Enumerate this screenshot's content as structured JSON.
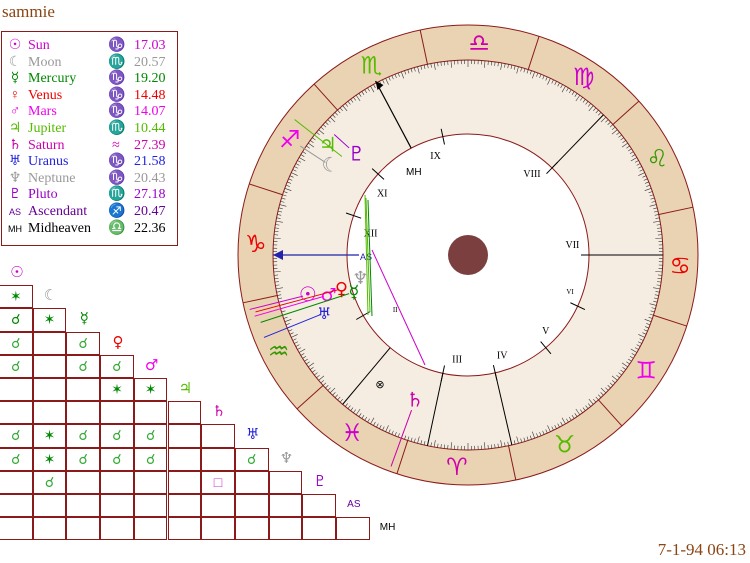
{
  "chart_title": "sammie",
  "datetime": "7-1-94 06:13",
  "colors": {
    "border": "#8b1a1a",
    "ring": "#ead3b2",
    "inner": "#f5ede2",
    "center": "#7b3f3f",
    "text": "#8b4513"
  },
  "planets": [
    {
      "key": "sun",
      "glyph": "☉",
      "name": "Sun",
      "sign": "♑",
      "degree": "17.03",
      "color": "#cc00cc"
    },
    {
      "key": "moon",
      "glyph": "☾",
      "name": "Moon",
      "sign": "♏",
      "degree": "20.57",
      "color": "#999999"
    },
    {
      "key": "mercury",
      "glyph": "☿",
      "name": "Mercury",
      "sign": "♑",
      "degree": "19.20",
      "color": "#008800"
    },
    {
      "key": "venus",
      "glyph": "♀",
      "name": "Venus",
      "sign": "♑",
      "degree": "14.48",
      "color": "#ee0000"
    },
    {
      "key": "mars",
      "glyph": "♂",
      "name": "Mars",
      "sign": "♑",
      "degree": "14.07",
      "color": "#ee00ee"
    },
    {
      "key": "jupiter",
      "glyph": "♃",
      "name": "Jupiter",
      "sign": "♏",
      "degree": "10.44",
      "color": "#55bb00"
    },
    {
      "key": "saturn",
      "glyph": "♄",
      "name": "Saturn",
      "sign": "≈",
      "degree": "27.39",
      "color": "#cc00aa"
    },
    {
      "key": "uranus",
      "glyph": "♅",
      "name": "Uranus",
      "sign": "♑",
      "degree": "21.58",
      "color": "#2222dd"
    },
    {
      "key": "neptune",
      "glyph": "♆",
      "name": "Neptune",
      "sign": "♑",
      "degree": "20.43",
      "color": "#999999"
    },
    {
      "key": "pluto",
      "glyph": "♇",
      "name": "Pluto",
      "sign": "♏",
      "degree": "27.18",
      "color": "#9900cc"
    },
    {
      "key": "ascendant",
      "glyph": "AS",
      "name": "Ascendant",
      "sign": "♐",
      "degree": "20.47",
      "color": "#660099"
    },
    {
      "key": "midheaven",
      "glyph": "MH",
      "name": "Midheaven",
      "sign": "♎",
      "degree": "22.36",
      "color": "#000000"
    }
  ],
  "aspect_rows": [
    {
      "glyph": "☉",
      "color": "#cc00cc",
      "cells": []
    },
    {
      "glyph": "☾",
      "color": "#999999",
      "cells": [
        {
          "s": "✶",
          "c": "#008800"
        }
      ]
    },
    {
      "glyph": "☿",
      "color": "#008800",
      "cells": [
        {
          "s": "☌",
          "c": "#008800"
        },
        {
          "s": "✶",
          "c": "#008800"
        }
      ]
    },
    {
      "glyph": "♀",
      "color": "#ee0000",
      "cells": [
        {
          "s": "☌",
          "c": "#33aa33"
        },
        {
          "s": "",
          "c": ""
        },
        {
          "s": "☌",
          "c": "#33aa33"
        }
      ]
    },
    {
      "glyph": "♂",
      "color": "#ee00ee",
      "cells": [
        {
          "s": "☌",
          "c": "#33aa33"
        },
        {
          "s": "",
          "c": ""
        },
        {
          "s": "☌",
          "c": "#33aa33"
        },
        {
          "s": "☌",
          "c": "#33aa33"
        }
      ]
    },
    {
      "glyph": "♃",
      "color": "#55bb00",
      "cells": [
        {
          "s": "",
          "c": ""
        },
        {
          "s": "",
          "c": ""
        },
        {
          "s": "",
          "c": ""
        },
        {
          "s": "✶",
          "c": "#008800"
        },
        {
          "s": "✶",
          "c": "#008800"
        }
      ]
    },
    {
      "glyph": "♄",
      "color": "#cc00aa",
      "cells": [
        {
          "s": "",
          "c": ""
        },
        {
          "s": "",
          "c": ""
        },
        {
          "s": "",
          "c": ""
        },
        {
          "s": "",
          "c": ""
        },
        {
          "s": "",
          "c": ""
        },
        {
          "s": "",
          "c": ""
        }
      ]
    },
    {
      "glyph": "♅",
      "color": "#2222dd",
      "cells": [
        {
          "s": "☌",
          "c": "#33aa33"
        },
        {
          "s": "✶",
          "c": "#008800"
        },
        {
          "s": "☌",
          "c": "#33aa33"
        },
        {
          "s": "☌",
          "c": "#33aa33"
        },
        {
          "s": "☌",
          "c": "#33aa33"
        },
        {
          "s": "",
          "c": ""
        },
        {
          "s": "",
          "c": ""
        }
      ]
    },
    {
      "glyph": "♆",
      "color": "#999999",
      "cells": [
        {
          "s": "☌",
          "c": "#33aa33"
        },
        {
          "s": "✶",
          "c": "#008800"
        },
        {
          "s": "☌",
          "c": "#33aa33"
        },
        {
          "s": "☌",
          "c": "#33aa33"
        },
        {
          "s": "☌",
          "c": "#33aa33"
        },
        {
          "s": "",
          "c": ""
        },
        {
          "s": "",
          "c": ""
        },
        {
          "s": "☌",
          "c": "#33aa33"
        }
      ]
    },
    {
      "glyph": "♇",
      "color": "#9900cc",
      "cells": [
        {
          "s": "",
          "c": ""
        },
        {
          "s": "☌",
          "c": "#33aa33"
        },
        {
          "s": "",
          "c": ""
        },
        {
          "s": "",
          "c": ""
        },
        {
          "s": "",
          "c": ""
        },
        {
          "s": "",
          "c": ""
        },
        {
          "s": "□",
          "c": "#cc33cc"
        },
        {
          "s": "",
          "c": ""
        },
        {
          "s": "",
          "c": ""
        }
      ]
    },
    {
      "glyph": "AS",
      "color": "#660099",
      "cells": [
        {
          "s": "",
          "c": ""
        },
        {
          "s": "",
          "c": ""
        },
        {
          "s": "",
          "c": ""
        },
        {
          "s": "",
          "c": ""
        },
        {
          "s": "",
          "c": ""
        },
        {
          "s": "",
          "c": ""
        },
        {
          "s": "",
          "c": ""
        },
        {
          "s": "",
          "c": ""
        },
        {
          "s": "",
          "c": ""
        },
        {
          "s": "",
          "c": ""
        }
      ]
    },
    {
      "glyph": "MH",
      "color": "#000000",
      "cells": [
        {
          "s": "",
          "c": ""
        },
        {
          "s": "",
          "c": ""
        },
        {
          "s": "",
          "c": ""
        },
        {
          "s": "",
          "c": ""
        },
        {
          "s": "",
          "c": ""
        },
        {
          "s": "",
          "c": ""
        },
        {
          "s": "",
          "c": ""
        },
        {
          "s": "",
          "c": ""
        },
        {
          "s": "",
          "c": ""
        },
        {
          "s": "",
          "c": ""
        },
        {
          "s": "",
          "c": ""
        }
      ]
    }
  ],
  "wheel": {
    "zodiac": [
      {
        "glyph": "♍",
        "color": "#cc00cc"
      },
      {
        "glyph": "♌",
        "color": "#339900"
      },
      {
        "glyph": "♋",
        "color": "#ee0000"
      },
      {
        "glyph": "♊",
        "color": "#ee00ee"
      },
      {
        "glyph": "♉",
        "color": "#55bb00"
      },
      {
        "glyph": "♈",
        "color": "#cc00aa"
      },
      {
        "glyph": "♓",
        "color": "#cc00cc"
      },
      {
        "glyph": "♒",
        "color": "#339900"
      },
      {
        "glyph": "♑",
        "color": "#ee0000"
      },
      {
        "glyph": "♐",
        "color": "#ee00ee"
      },
      {
        "glyph": "♏",
        "color": "#55bb00"
      },
      {
        "glyph": "♎",
        "color": "#cc00aa"
      }
    ],
    "houses": [
      "IX",
      "VIII",
      "VII",
      "VI",
      "V",
      "IV",
      "III",
      "II",
      "XII",
      "XI",
      "MH",
      "AS"
    ],
    "part_of_fortune": "⊗",
    "wheel_planets": [
      {
        "key": "jupiter",
        "glyph": "♃",
        "color": "#55bb00"
      },
      {
        "key": "moon",
        "glyph": "☾",
        "color": "#999999"
      },
      {
        "key": "pluto",
        "glyph": "♇",
        "color": "#9900cc"
      },
      {
        "key": "sun",
        "glyph": "☉",
        "color": "#cc00cc"
      },
      {
        "key": "mars",
        "glyph": "♂",
        "color": "#ee00ee"
      },
      {
        "key": "venus",
        "glyph": "♀",
        "color": "#ee0000"
      },
      {
        "key": "mercury",
        "glyph": "☿",
        "color": "#008800"
      },
      {
        "key": "neptune",
        "glyph": "♆",
        "color": "#999999"
      },
      {
        "key": "uranus",
        "glyph": "♅",
        "color": "#2222dd"
      },
      {
        "key": "saturn",
        "glyph": "♄",
        "color": "#cc00aa"
      }
    ]
  }
}
